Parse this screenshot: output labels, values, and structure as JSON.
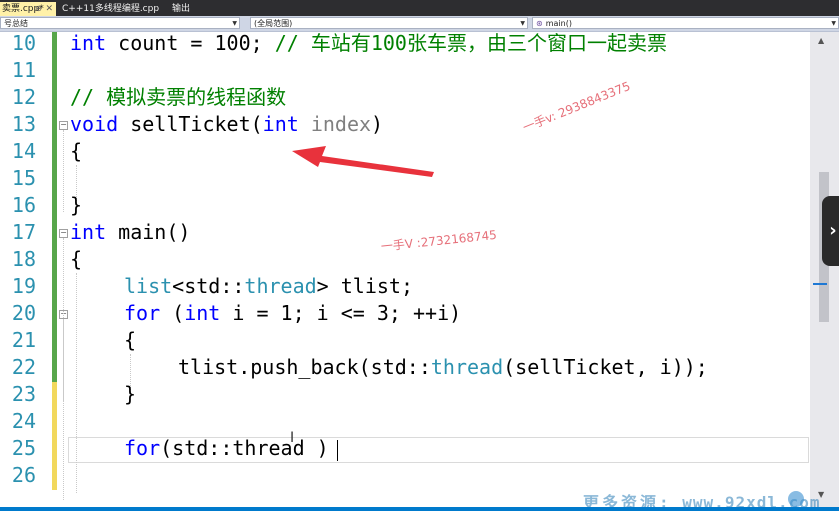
{
  "tabs": [
    {
      "label": "卖票.cpp*",
      "active": true,
      "pin_icon": "pin-icon",
      "close_icon": "close-icon"
    },
    {
      "label": "C++11多线程编程.cpp",
      "active": false
    },
    {
      "label": "输出",
      "active": false
    }
  ],
  "navbar": {
    "project": "号总结",
    "scope": "(全局范围)",
    "member": "main()",
    "member_icon": "function-icon"
  },
  "editor": {
    "line_numbers": [
      "10",
      "11",
      "12",
      "13",
      "14",
      "15",
      "16",
      "17",
      "18",
      "19",
      "20",
      "21",
      "22",
      "23",
      "24",
      "25",
      "26"
    ],
    "lines": {
      "l10": {
        "kw1": "int",
        "plain1": " count = 100; ",
        "comment": "// 车站有100张车票，由三个窗口一起卖票"
      },
      "l12": {
        "comment": "// 模拟卖票的线程函数"
      },
      "l13": {
        "kw1": "void",
        "plain1": " sellTicket(",
        "kw2": "int",
        "param": " index",
        "plain2": ")"
      },
      "l14": {
        "plain1": "{"
      },
      "l16": {
        "plain1": "}"
      },
      "l17": {
        "kw1": "int",
        "plain1": " main()"
      },
      "l18": {
        "plain1": "{"
      },
      "l19": {
        "ty1": "list",
        "plain1": "<std::",
        "ty2": "thread",
        "plain2": "> tlist;"
      },
      "l20": {
        "kw1": "for",
        "plain1": " (",
        "kw2": "int",
        "plain2": " i = 1; i <= 3; ++i)"
      },
      "l21": {
        "plain1": "{"
      },
      "l22": {
        "plain1": "tlist.push_back(std::",
        "ty1": "thread",
        "plain2": "(sellTicket, i));"
      },
      "l23": {
        "plain1": "}"
      },
      "l25": {
        "kw1": "for",
        "plain1": "(std::thread )"
      }
    }
  },
  "watermarks": {
    "w1": "一手v: 2938843375",
    "w2": "一手V :2732168745",
    "w3_cn": "更多资源:",
    "w3_url": "www.92xdl.com"
  },
  "overlay_button": "›",
  "colors": {
    "keyword": "#0000ff",
    "type": "#2b91af",
    "comment": "#008000",
    "line_number": "#2b91af",
    "change_saved": "#57a64a",
    "change_unsaved": "#f2d85c",
    "annotation_arrow": "#e8323c"
  }
}
